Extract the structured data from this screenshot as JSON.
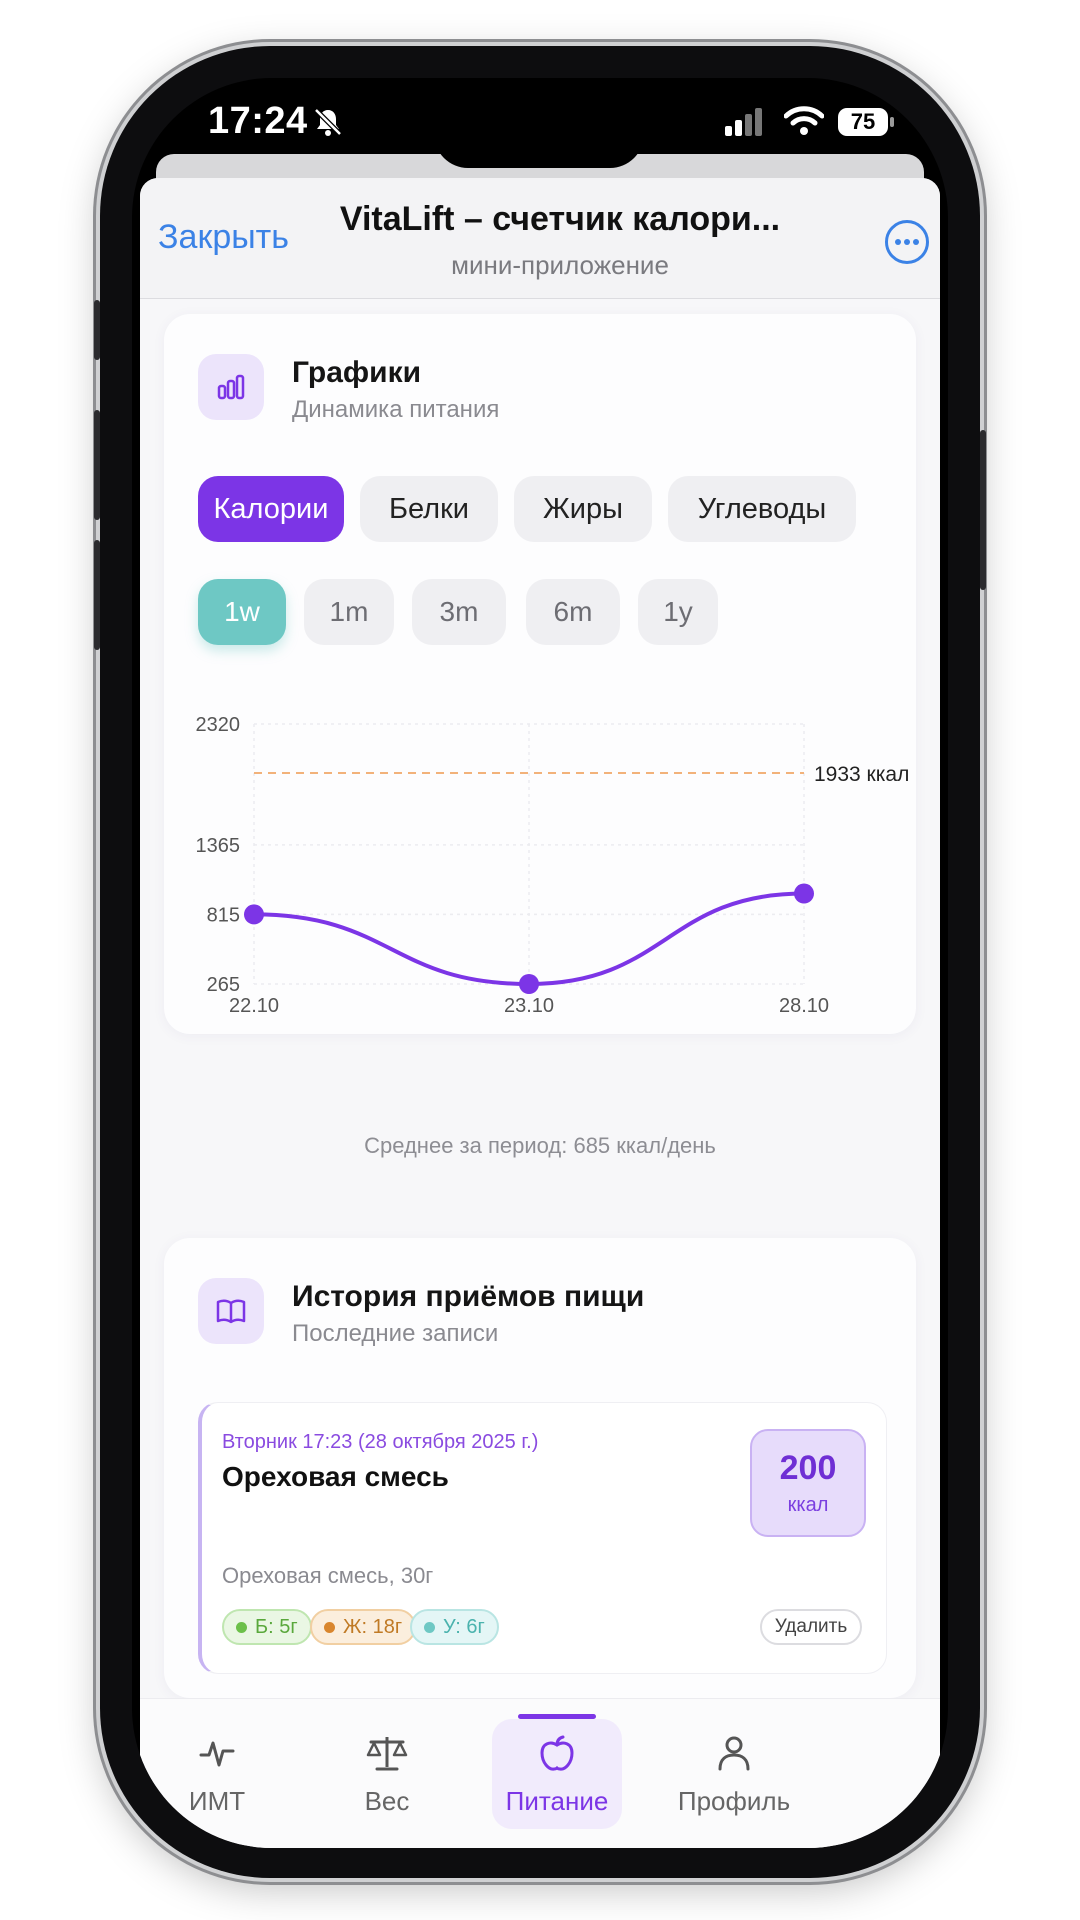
{
  "status_bar": {
    "time": "17:24",
    "battery": "75"
  },
  "nav": {
    "close_label": "Закрыть",
    "title": "VitaLift – счетчик калори...",
    "subtitle": "мини-приложение"
  },
  "charts_card": {
    "title": "Графики",
    "subtitle": "Динамика питания",
    "metric_tabs": [
      "Калории",
      "Белки",
      "Жиры",
      "Углеводы"
    ],
    "active_metric": "Калории",
    "period_tabs": [
      "1w",
      "1m",
      "3m",
      "6m",
      "1y"
    ],
    "active_period": "1w",
    "average_text": "Среднее за период: 685 ккал/день"
  },
  "chart_data": {
    "type": "line",
    "x": [
      "22.10",
      "23.10",
      "28.10"
    ],
    "series": [
      {
        "values": [
          815,
          265,
          980
        ]
      }
    ],
    "y_ticks": [
      265,
      815,
      1365,
      2320
    ],
    "ylim": [
      265,
      2320
    ],
    "target_line": {
      "value": 1933,
      "label": "1933 ккал"
    },
    "grid": true,
    "colors": {
      "line": "#7c35e6",
      "target": "#f2b27a"
    }
  },
  "history_card": {
    "title": "История приёмов пищи",
    "subtitle": "Последние записи",
    "entries": [
      {
        "date": "Вторник 17:23 (28 октября 2025 г.)",
        "name": "Ореховая смесь",
        "description": "Ореховая смесь, 30г",
        "kcal_value": "200",
        "kcal_unit": "ккал",
        "protein": "Б: 5г",
        "fat": "Ж: 18г",
        "carbs": "У: 6г",
        "delete_label": "Удалить"
      }
    ]
  },
  "tabbar": {
    "items": [
      {
        "label": "ИМТ",
        "icon": "pulse-icon"
      },
      {
        "label": "Вес",
        "icon": "scale-icon"
      },
      {
        "label": "Питание",
        "icon": "apple-icon"
      },
      {
        "label": "Профиль",
        "icon": "person-icon"
      }
    ],
    "active": "Питание"
  },
  "colors": {
    "accent": "#7c35e6",
    "period_active": "#6ec8c4",
    "link": "#3b82e6"
  }
}
